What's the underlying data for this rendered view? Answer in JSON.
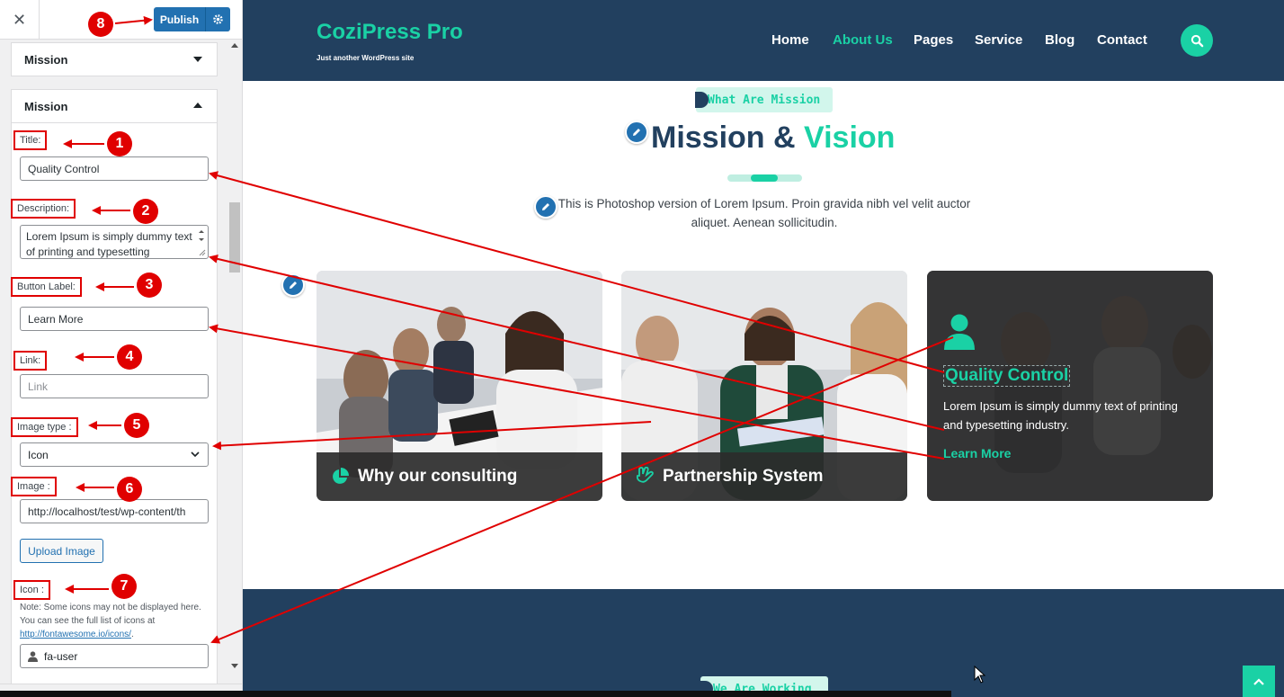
{
  "customizer": {
    "close_icon": "close-icon",
    "publish_label": "Publish",
    "collapsed_section_title": "Mission",
    "open_section_title": "Mission",
    "fields": {
      "title_label": "Title:",
      "title_value": "Quality Control",
      "description_label": "Description:",
      "description_value": "Lorem Ipsum is simply dummy text of  printing and typesetting",
      "button_label_label": "Button Label:",
      "button_label_value": "Learn More",
      "link_label": "Link:",
      "link_placeholder": "Link",
      "image_type_label": "Image type :",
      "image_type_value": "Icon",
      "image_label": "Image :",
      "image_value": "http://localhost/test/wp-content/th",
      "upload_label": "Upload Image",
      "icon_label": "Icon :",
      "icon_note": "Note: Some icons may not be displayed here. You can see the full list of icons at",
      "icon_note_link": "http://fontawesome.io/icons/",
      "icon_note_end": ".",
      "icon_value": "fa-user"
    },
    "badges": [
      "1",
      "2",
      "3",
      "4",
      "5",
      "6",
      "7",
      "8"
    ]
  },
  "site": {
    "title": "CoziPress Pro",
    "tagline": "Just another WordPress site",
    "nav": [
      "Home",
      "About Us",
      "Pages",
      "Service",
      "Blog",
      "Contact"
    ],
    "active_nav": "About Us",
    "mission_pill": "What Are Mission",
    "heading_part1": "Mission &",
    "heading_part2": "Vision",
    "description": "This is Photoshop version of Lorem Ipsum. Proin gravida nibh vel velit auctor aliquet. Aenean sollicitudin.",
    "cards": [
      {
        "title": "Why our consulting",
        "icon": "pie-chart-icon"
      },
      {
        "title": "Partnership System",
        "icon": "handshake-icon"
      }
    ],
    "featured_card": {
      "icon": "user-icon",
      "title": "Quality Control",
      "description": "Lorem Ipsum is simply dummy text of printing and typesetting industry.",
      "button": "Learn More"
    },
    "working_pill": "We Are Working"
  },
  "colors": {
    "accent": "#1ad1a5",
    "header_bg": "#22405f",
    "wp_blue": "#2271b1",
    "annotation_red": "#e00000"
  }
}
